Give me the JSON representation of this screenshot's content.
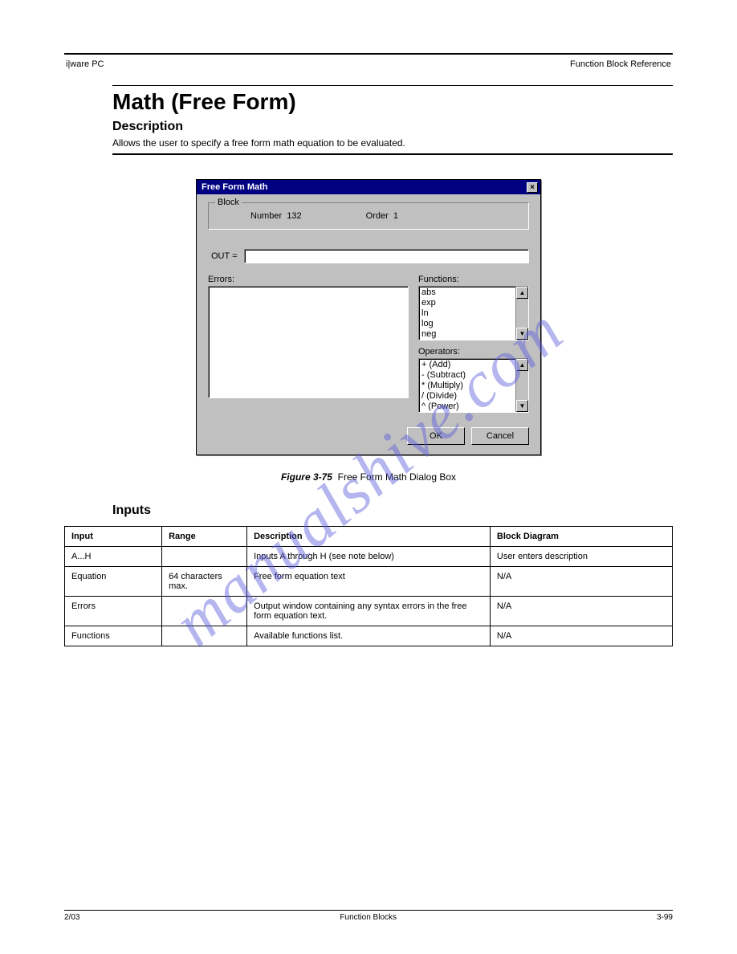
{
  "header": {
    "left": "i|ware PC",
    "right": "Function Block Reference"
  },
  "page_title": "Math (Free Form)",
  "subtitle": "Description",
  "description": "Allows the user to specify a free form math equation to be evaluated.",
  "dialog": {
    "title": "Free Form Math",
    "close": "×",
    "block_legend": "Block",
    "number_label": "Number",
    "number_value": "132",
    "order_label": "Order",
    "order_value": "1",
    "out_label": "OUT =",
    "out_value": "",
    "errors_label": "Errors:",
    "functions_label": "Functions:",
    "functions": [
      "abs",
      "exp",
      "ln",
      "log",
      "neg"
    ],
    "operators_label": "Operators:",
    "operators": [
      "+ (Add)",
      "- (Subtract)",
      "* (Multiply)",
      "/ (Divide)",
      "^ (Power)"
    ],
    "ok": "OK",
    "cancel": "Cancel"
  },
  "figure": {
    "num": "Figure 3-75",
    "caption": "Free Form Math Dialog Box"
  },
  "section": "Inputs",
  "table": {
    "headers": [
      "Input",
      "Range",
      "Description",
      "Block Diagram"
    ],
    "rows": [
      [
        "A...H",
        "",
        "Inputs A through H (see note below)",
        "User enters description"
      ],
      [
        "Equation",
        "64 characters max.",
        "Free form equation text",
        "N/A"
      ],
      [
        "Errors",
        "",
        "Output window containing any syntax errors in the free form equation text.",
        "N/A"
      ],
      [
        "Functions",
        "",
        "Available functions list.",
        "N/A"
      ]
    ]
  },
  "footer": {
    "left": "2/03",
    "center": "Function Blocks",
    "right": "3-99"
  },
  "watermark": "manualshive.com"
}
